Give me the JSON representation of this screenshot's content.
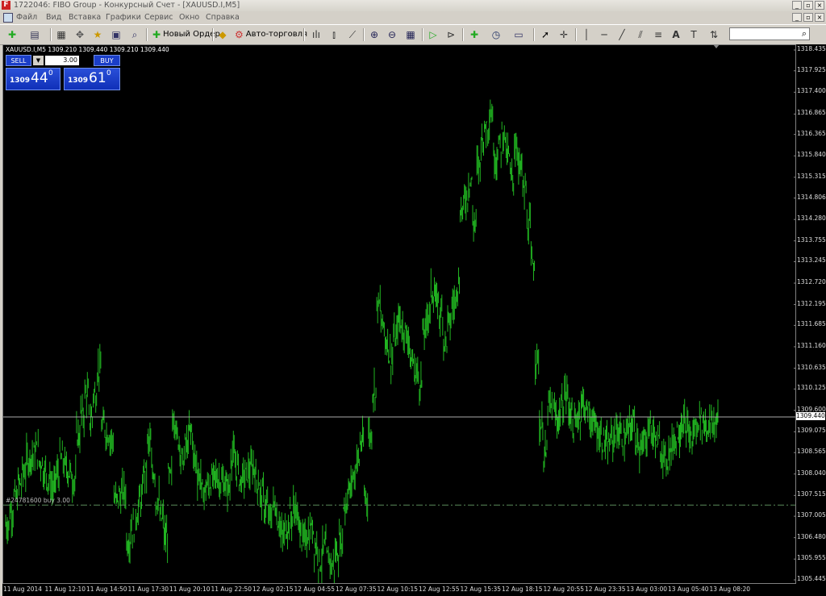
{
  "window": {
    "title": "1722046: FIBO Group - Конкурсный Счет - [XAUUSD.I,M5]",
    "app_icon_letter": "F"
  },
  "menu": {
    "items": [
      "Файл",
      "Вид",
      "Вставка",
      "Графики",
      "Сервис",
      "Окно",
      "Справка"
    ]
  },
  "toolbar": {
    "new_order_label": "Новый Ордер",
    "autotrading_label": "Авто-торговля",
    "search_placeholder": ""
  },
  "chart": {
    "header": "XAUUSD.I,M5  1309.210 1309.440 1309.210 1309.440",
    "one_click": {
      "sell_label": "SELL",
      "buy_label": "BUY",
      "lot": "3.00",
      "sell_price_small": "1309",
      "sell_price_big": "44",
      "sell_price_sup": "0",
      "buy_price_small": "1309",
      "buy_price_big": "61",
      "buy_price_sup": "0"
    },
    "order_line_label": "#24781600 buy 3.00",
    "bid_line_label": "1309.440",
    "colors": {
      "background": "#000000",
      "bars": "#21b421",
      "bid_line": "#aaaaaa",
      "order_line": "#5a8a5a"
    }
  },
  "chart_data": {
    "type": "bar",
    "symbol": "XAUUSD.I",
    "timeframe": "M5",
    "y_ticks": [
      "1318.435",
      "1317.925",
      "1317.400",
      "1316.865",
      "1316.365",
      "1315.840",
      "1315.315",
      "1314.806",
      "1314.280",
      "1313.755",
      "1313.245",
      "1312.720",
      "1312.195",
      "1311.685",
      "1311.160",
      "1310.635",
      "1310.125",
      "1309.600",
      "1309.075",
      "1308.565",
      "1308.040",
      "1307.515",
      "1307.005",
      "1306.480",
      "1305.955",
      "1305.445"
    ],
    "x_ticks": [
      "11 Aug 2014",
      "11 Aug 12:10",
      "11 Aug 14:50",
      "11 Aug 17:30",
      "11 Aug 20:10",
      "11 Aug 22:50",
      "12 Aug 02:15",
      "12 Aug 04:55",
      "12 Aug 07:35",
      "12 Aug 10:15",
      "12 Aug 12:55",
      "12 Aug 15:35",
      "12 Aug 18:15",
      "12 Aug 20:55",
      "12 Aug 23:35",
      "13 Aug 03:00",
      "13 Aug 05:40",
      "13 Aug 08:20"
    ],
    "ylim": [
      1305.445,
      1318.435
    ],
    "bid": 1309.44,
    "open_order_price": 1307.28,
    "price_path": [
      [
        0,
        1306.8
      ],
      [
        3,
        1307.8
      ],
      [
        5,
        1308.4
      ],
      [
        7,
        1308.6
      ],
      [
        9,
        1308.1
      ],
      [
        11,
        1307.7
      ],
      [
        13,
        1308.4
      ],
      [
        16,
        1307.9
      ],
      [
        17,
        1309.0
      ],
      [
        19,
        1310.0
      ],
      [
        20,
        1309.4
      ],
      [
        22,
        1310.6
      ],
      [
        23,
        1309.2
      ],
      [
        25,
        1308.9
      ],
      [
        26,
        1307.4
      ],
      [
        28,
        1307.6
      ],
      [
        29,
        1306.4
      ],
      [
        32,
        1307.4
      ],
      [
        34,
        1308.8
      ],
      [
        36,
        1307.4
      ],
      [
        38,
        1306.5
      ],
      [
        40,
        1309.4
      ],
      [
        42,
        1308.4
      ],
      [
        44,
        1309.1
      ],
      [
        45,
        1308.4
      ],
      [
        47,
        1307.6
      ],
      [
        50,
        1308.0
      ],
      [
        53,
        1307.7
      ],
      [
        54,
        1308.5
      ],
      [
        56,
        1307.9
      ],
      [
        59,
        1308.2
      ],
      [
        61,
        1307.5
      ],
      [
        63,
        1307.0
      ],
      [
        64,
        1307.3
      ],
      [
        66,
        1306.5
      ],
      [
        69,
        1307.2
      ],
      [
        71,
        1306.4
      ],
      [
        73,
        1306.7
      ],
      [
        75,
        1305.9
      ],
      [
        76,
        1306.2
      ],
      [
        78,
        1305.8
      ],
      [
        80,
        1306.4
      ],
      [
        81,
        1307.3
      ],
      [
        83,
        1308.0
      ],
      [
        85,
        1308.8
      ],
      [
        86,
        1307.5
      ],
      [
        87,
        1309.0
      ],
      [
        88,
        1310.1
      ],
      [
        89,
        1312.2
      ],
      [
        90,
        1311.7
      ],
      [
        92,
        1310.9
      ],
      [
        94,
        1311.8
      ],
      [
        96,
        1311.4
      ],
      [
        97,
        1310.8
      ],
      [
        99,
        1310.3
      ],
      [
        100,
        1311.5
      ],
      [
        102,
        1312.5
      ],
      [
        104,
        1312.0
      ],
      [
        105,
        1311.3
      ],
      [
        107,
        1312.2
      ],
      [
        108,
        1312.7
      ],
      [
        109,
        1314.5
      ],
      [
        111,
        1315.2
      ],
      [
        112,
        1314.2
      ],
      [
        113,
        1315.6
      ],
      [
        114,
        1316.3
      ],
      [
        116,
        1316.9
      ],
      [
        117,
        1315.8
      ],
      [
        119,
        1316.4
      ],
      [
        121,
        1315.3
      ],
      [
        122,
        1316.1
      ],
      [
        124,
        1315.0
      ],
      [
        125,
        1314.1
      ],
      [
        126,
        1313.2
      ],
      [
        127,
        1310.9
      ],
      [
        128,
        1309.2
      ],
      [
        129,
        1308.5
      ],
      [
        130,
        1309.7
      ],
      [
        132,
        1309.4
      ],
      [
        134,
        1310.0
      ],
      [
        136,
        1309.2
      ],
      [
        138,
        1309.8
      ],
      [
        140,
        1309.4
      ],
      [
        142,
        1309.0
      ],
      [
        144,
        1308.7
      ],
      [
        146,
        1309.1
      ],
      [
        148,
        1308.9
      ],
      [
        150,
        1309.3
      ],
      [
        152,
        1308.6
      ],
      [
        154,
        1309.2
      ],
      [
        156,
        1308.8
      ],
      [
        158,
        1308.4
      ],
      [
        160,
        1308.9
      ],
      [
        162,
        1309.3
      ],
      [
        164,
        1308.9
      ],
      [
        166,
        1309.4
      ],
      [
        168,
        1309.2
      ],
      [
        170,
        1309.3
      ]
    ],
    "n_bars": 171
  }
}
